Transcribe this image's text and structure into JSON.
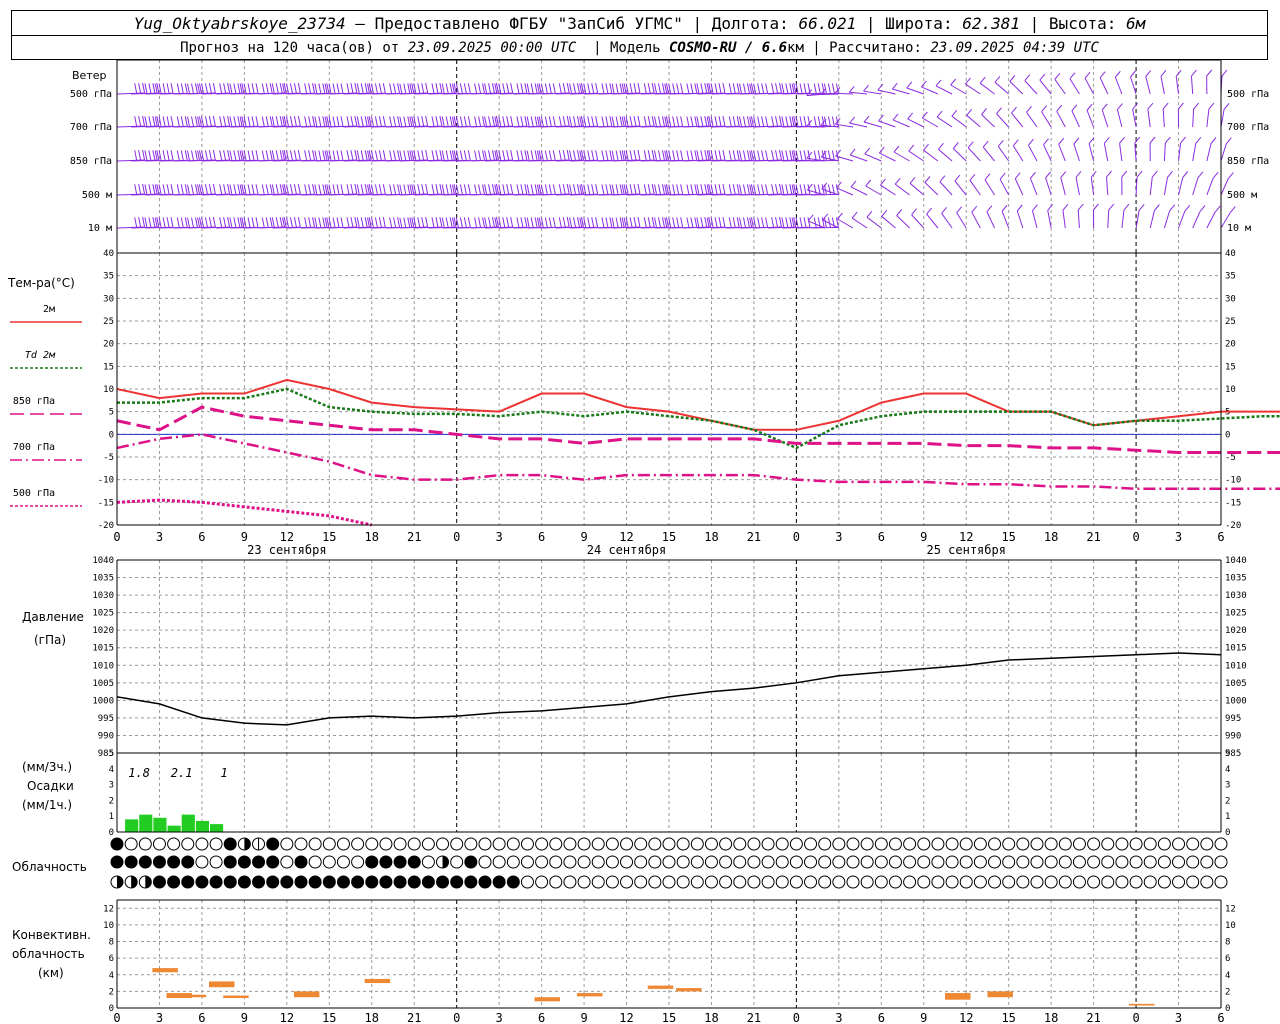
{
  "header": {
    "station": "Yug_Oktyabrskoye_23734",
    "provided_prefix": "–  Предоставлено ФГБУ",
    "provider": "\"ЗапСиб УГМС\"",
    "lon_label": "Долгота:",
    "lon": "66.021",
    "lat_label": "Широта:",
    "lat": "62.381",
    "alt_label": "Высота:",
    "alt": "6м",
    "forecast_prefix": "Прогноз на 120 часа(ов) от",
    "forecast_date": "23.09.2025 00:00 UTC",
    "model_label": "Модель",
    "model": "COSMO-RU / 6.6",
    "model_unit": "км",
    "calc_label": "Рассчитано:",
    "calc_date": "23.09.2025 04:39 UTC"
  },
  "labels": {
    "wind": "Ветер",
    "wind_levels": [
      "500 гПа",
      "700 гПа",
      "850 гПа",
      "500 м",
      "10  м"
    ],
    "temp": "Тем-ра(°C)",
    "pressure": [
      "Давление",
      "(гПа)"
    ],
    "precip": [
      "(мм/3ч.)",
      "Осадки",
      "(мм/1ч.)"
    ],
    "cloud": "Облачность",
    "conv": [
      "Конвективн.",
      "облачность",
      "(км)"
    ]
  },
  "colors": {
    "wind": "#8a2be2",
    "t2m": "#ee3333",
    "td2m": "#1a7a1a",
    "lvl": "#dd1188",
    "precip": "#22cc22",
    "conv": "#ee8833",
    "grid": "#9a9a9a"
  },
  "chart_data": [
    {
      "type": "line",
      "title": "Тем-ра(°C)",
      "x_hours": [
        0,
        3,
        6,
        9,
        12,
        15,
        18,
        21,
        24,
        27,
        30,
        33,
        36,
        39,
        42,
        45,
        48,
        51,
        54,
        57,
        60,
        63,
        66,
        69,
        72,
        75,
        78,
        81,
        84,
        87,
        90,
        93,
        96,
        99,
        102,
        105,
        108,
        111,
        114,
        117,
        120
      ],
      "x_tick_labels": [
        "0",
        "3",
        "6",
        "9",
        "12",
        "15",
        "18",
        "21",
        "0",
        "3",
        "6",
        "9",
        "12",
        "15",
        "18",
        "21",
        "0",
        "3",
        "6",
        "9",
        "12",
        "15",
        "18",
        "21",
        "0",
        "3",
        "6"
      ],
      "date_labels": [
        "23 сентября",
        "24 сентября",
        "25 сентября"
      ],
      "ylim": [
        -20,
        40
      ],
      "series": [
        {
          "name": "2м",
          "values": [
            10,
            8,
            9,
            9,
            12,
            10,
            7,
            6,
            5.5,
            5,
            9,
            9,
            6,
            5,
            3,
            1,
            1,
            3,
            7,
            9,
            9,
            5,
            5,
            2,
            3,
            4,
            5,
            5,
            5,
            5,
            5,
            5,
            5,
            5,
            5,
            5,
            5,
            5,
            5,
            5,
            5
          ]
        },
        {
          "name": "Td  2м",
          "values": [
            7,
            7,
            8,
            8,
            10,
            6,
            5,
            4.5,
            4.5,
            4,
            5,
            4,
            5,
            4,
            3,
            1,
            -3,
            2,
            4,
            5,
            5,
            5,
            5,
            2,
            3,
            3,
            3.5,
            4,
            4,
            4,
            4,
            4,
            4,
            4,
            4,
            4,
            4,
            4,
            4,
            4,
            4
          ]
        },
        {
          "name": "850 гПа",
          "values": [
            3,
            1,
            6,
            4,
            3,
            2,
            1,
            1,
            0,
            -1,
            -1,
            -2,
            -1,
            -1,
            -1,
            -1,
            -2,
            -2,
            -2,
            -2,
            -2.5,
            -2.5,
            -3,
            -3,
            -3.5,
            -4,
            -4,
            -4,
            -4,
            -4,
            -4,
            -4,
            -4,
            -4,
            -4,
            -4,
            -4,
            -4,
            -4,
            -4,
            -4
          ]
        },
        {
          "name": "700 гПа",
          "values": [
            -3,
            -1,
            0,
            -2,
            -4,
            -6,
            -9,
            -10,
            -10,
            -9,
            -9,
            -10,
            -9,
            -9,
            -9,
            -9,
            -10,
            -10.5,
            -10.5,
            -10.5,
            -11,
            -11,
            -11.5,
            -11.5,
            -12,
            -12,
            -12,
            -12,
            -12,
            -12,
            -12,
            -12,
            -12,
            -12,
            -12,
            -12,
            -12,
            -12,
            -12,
            -12,
            -12
          ]
        },
        {
          "name": "500 гПа",
          "values": [
            -15,
            -14.5,
            -15,
            -16,
            -17,
            -18,
            -20
          ]
        }
      ]
    },
    {
      "type": "line",
      "title": "Давление (гПа)",
      "x_hours": [
        0,
        3,
        6,
        9,
        12,
        15,
        18,
        21,
        24,
        27,
        30,
        33,
        36,
        39,
        42,
        45,
        48,
        51,
        54,
        57,
        60,
        63,
        66,
        69,
        72,
        75,
        78
      ],
      "ylim": [
        985,
        1040
      ],
      "series": [
        {
          "name": "pressure",
          "values": [
            1001,
            999,
            995,
            993.5,
            993,
            995,
            995.5,
            995,
            995.5,
            996.5,
            997,
            998,
            999,
            1001,
            1002.5,
            1003.5,
            1005,
            1007,
            1008,
            1009,
            1010,
            1011.5,
            1012,
            1012.5,
            1013,
            1013.5,
            1013
          ]
        }
      ]
    },
    {
      "type": "bar",
      "title": "Осадки",
      "ylim": [
        0,
        5
      ],
      "labels_3h": [
        {
          "hour": 1,
          "text": "1.8"
        },
        {
          "hour": 4,
          "text": "2.1"
        },
        {
          "hour": 7,
          "text": "1"
        }
      ],
      "hours": [
        1,
        2,
        3,
        4,
        5,
        6,
        7,
        8
      ],
      "values": [
        0.8,
        1.1,
        0.9,
        0.4,
        1.1,
        0.7,
        0.5,
        0
      ]
    },
    {
      "type": "bar",
      "title": "Конвективн. облачность (км)",
      "ylim": [
        0,
        13
      ],
      "bars": [
        {
          "hour": 3,
          "bottom": 4.3,
          "top": 4.8
        },
        {
          "hour": 4,
          "bottom": 1.2,
          "top": 1.8
        },
        {
          "hour": 5,
          "bottom": 1.3,
          "top": 1.6
        },
        {
          "hour": 7,
          "bottom": 2.5,
          "top": 3.2
        },
        {
          "hour": 8,
          "bottom": 1.2,
          "top": 1.5
        },
        {
          "hour": 13,
          "bottom": 1.3,
          "top": 2.0
        },
        {
          "hour": 18,
          "bottom": 3.0,
          "top": 3.5
        },
        {
          "hour": 30,
          "bottom": 0.8,
          "top": 1.3
        },
        {
          "hour": 33,
          "bottom": 1.4,
          "top": 1.8
        },
        {
          "hour": 38,
          "bottom": 2.3,
          "top": 2.7
        },
        {
          "hour": 40,
          "bottom": 2.0,
          "top": 2.4
        },
        {
          "hour": 59,
          "bottom": 1.0,
          "top": 1.8
        },
        {
          "hour": 62,
          "bottom": 1.3,
          "top": 2.0
        },
        {
          "hour": 72,
          "bottom": 0.3,
          "top": 0.5
        }
      ]
    }
  ],
  "clouds": {
    "rows": [
      "10000000124100000000000000000000000000000000000000000000000000000000000000000000000000000000000000000000000000000000000000000",
      "11111100111101000011110301000000000000000000000000000000000000000000000000000000000000000000000000000000000000000000000000000",
      "23311111111111111111111111111000000000000000000000000000000000000000000000000000000000000000000000000000000000000000000000000"
    ]
  }
}
